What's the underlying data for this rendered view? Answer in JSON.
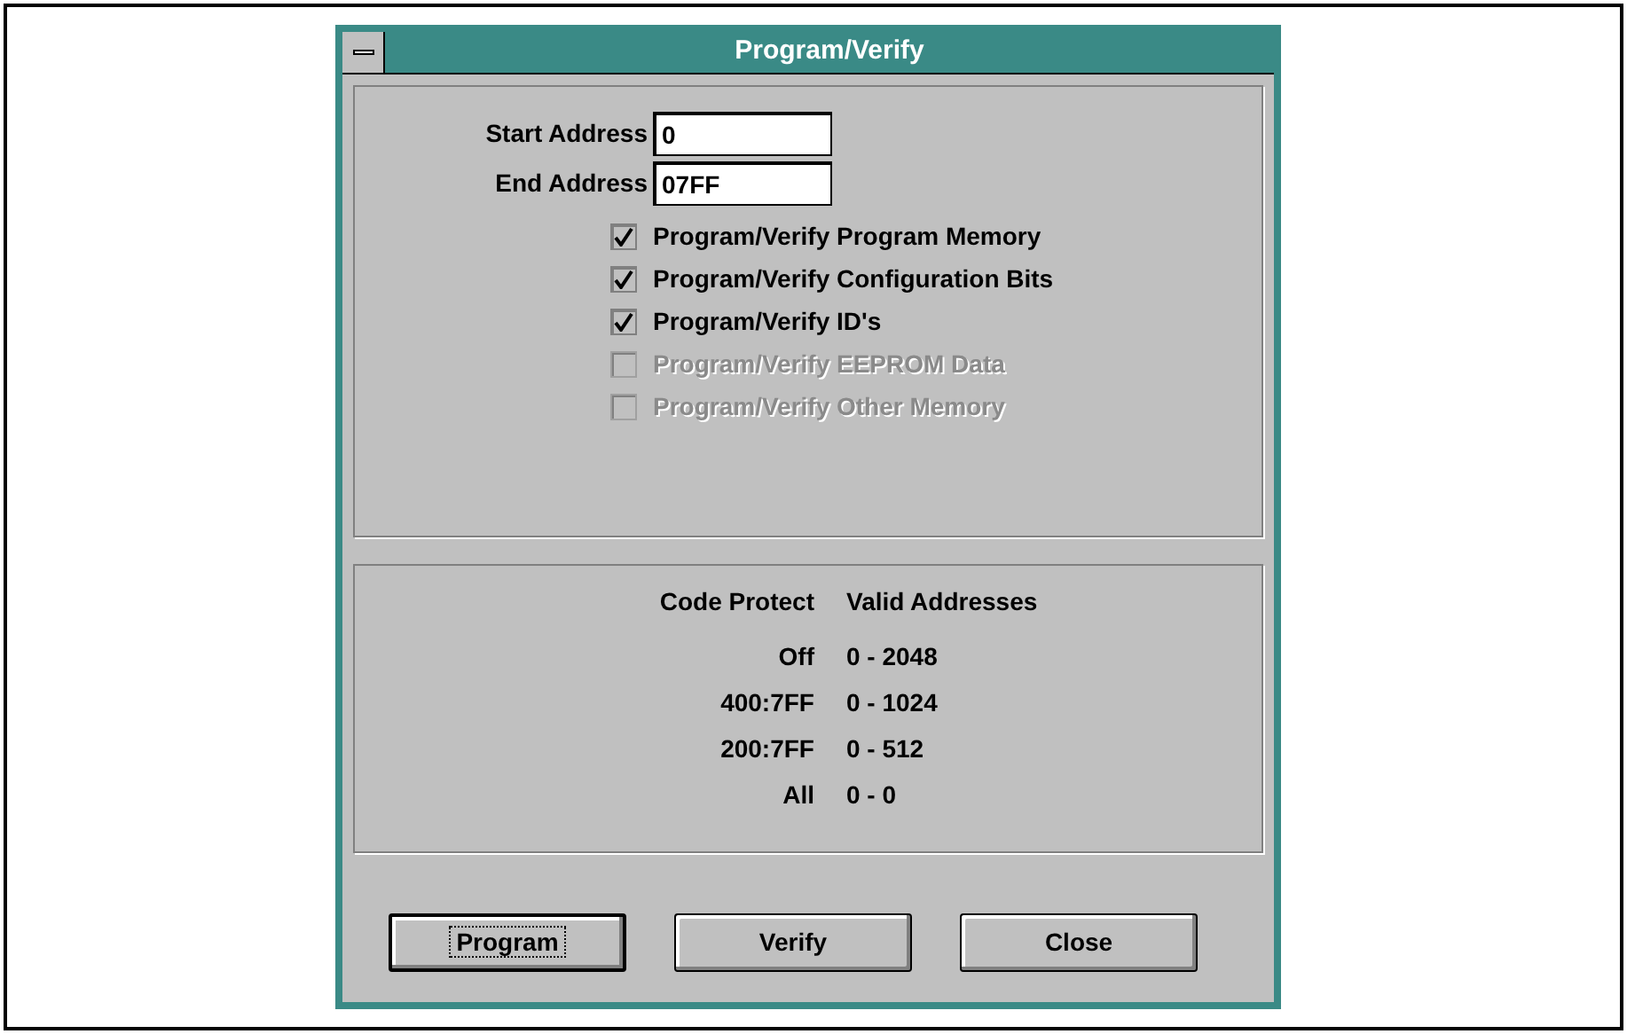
{
  "window": {
    "title": "Program/Verify"
  },
  "fields": [
    {
      "label": "Start Address",
      "value": "0"
    },
    {
      "label": "End Address",
      "value": "07FF"
    }
  ],
  "options": [
    {
      "label": "Program/Verify Program Memory",
      "checked": true,
      "disabled": false
    },
    {
      "label": "Program/Verify Configuration Bits",
      "checked": true,
      "disabled": false
    },
    {
      "label": "Program/Verify ID's",
      "checked": true,
      "disabled": false
    },
    {
      "label": "Program/Verify EEPROM Data",
      "checked": false,
      "disabled": true
    },
    {
      "label": "Program/Verify Other Memory",
      "checked": false,
      "disabled": true
    }
  ],
  "table": {
    "columns": [
      "Code Protect",
      "Valid Addresses"
    ],
    "rows": [
      [
        "Off",
        "0 - 2048"
      ],
      [
        "400:7FF",
        "0 - 1024"
      ],
      [
        "200:7FF",
        "0 - 512"
      ],
      [
        "All",
        "0 - 0"
      ]
    ]
  },
  "buttons": [
    {
      "label": "Program",
      "default": true
    },
    {
      "label": "Verify",
      "default": false
    },
    {
      "label": "Close",
      "default": false
    }
  ]
}
